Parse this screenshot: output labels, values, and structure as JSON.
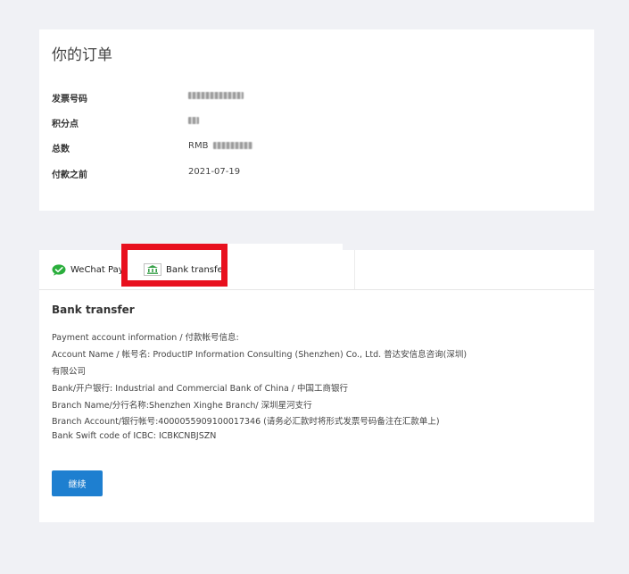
{
  "order": {
    "title": "你的订单",
    "rows": [
      {
        "label": "发票号码",
        "value": ""
      },
      {
        "label": "积分点",
        "value": ""
      },
      {
        "label": "总数",
        "value": "RMB"
      },
      {
        "label": "付款之前",
        "value": "2021-07-19"
      }
    ]
  },
  "payment": {
    "tabs": [
      {
        "label": "WeChat Pay",
        "icon": "wechat-icon"
      },
      {
        "label": "Bank transfer",
        "icon": "bank-icon"
      }
    ],
    "section_title": "Bank transfer",
    "lines": [
      "Payment account information / 付款帐号信息:",
      "Account Name / 帐号名: ProductIP Information Consulting (Shenzhen) Co., Ltd. 普达安信息咨询(深圳)",
      "有限公司",
      "Bank/开户银行: Industrial and Commercial Bank of China / 中国工商银行",
      "Branch Name/分行名称:Shenzhen Xinghe Branch/ 深圳星河支行",
      "Branch Account/银行帐号:4000055909100017346 (请务必汇款时将形式发票号码备注在汇款单上)",
      "Bank Swift code of ICBC: ICBKCNBJSZN"
    ],
    "continue_label": "继续"
  },
  "colors": {
    "accent": "#1e7fd0",
    "highlight": "#e8101e",
    "wechat_green": "#2aae3c",
    "bank_green": "#3aa14b",
    "background": "#f0f1f5"
  }
}
